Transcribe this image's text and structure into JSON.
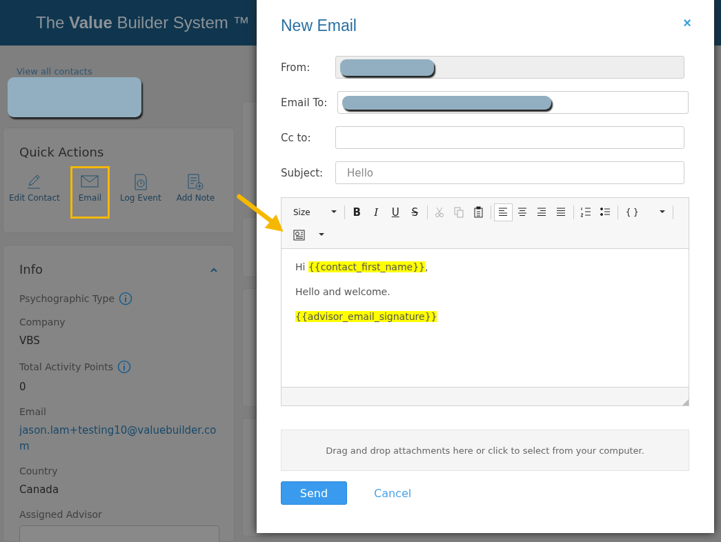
{
  "app_header": {
    "title": "The **Value** Builder System ™"
  },
  "contact": {
    "back_link": "View all contacts",
    "name_redacted": true
  },
  "quick_actions": {
    "title": "Quick Actions",
    "actions": [
      {
        "label": "Edit Contact",
        "highlighted": false
      },
      {
        "label": "Email",
        "highlighted": true
      },
      {
        "label": "Log Event",
        "highlighted": false
      },
      {
        "label": "Add Note",
        "highlighted": false
      }
    ]
  },
  "info": {
    "title": "Info",
    "expanded": true,
    "fields": [
      {
        "label": "Psychographic Type",
        "info": true,
        "kind": "text"
      },
      {
        "label": "Company",
        "value": "VBS",
        "info": false,
        "kind": "text"
      },
      {
        "label": "Total Activity Points",
        "value": "0",
        "info": true,
        "kind": "text"
      },
      {
        "label": "Email",
        "value": "jason.lam+testing10@valuebuilder.com",
        "info": false,
        "kind": "link"
      },
      {
        "label": "Country",
        "value": "Canada",
        "info": false,
        "kind": "text"
      },
      {
        "label": "Assigned Advisor",
        "info": false,
        "kind": "select"
      }
    ]
  },
  "dialog": {
    "title": "New Email",
    "close": "×",
    "fields": [
      {
        "label": "From:",
        "redacted": true,
        "disabled": true
      },
      {
        "label": "Email To:",
        "redacted": true,
        "disabled": false
      },
      {
        "label": "Cc to:",
        "redacted": false,
        "disabled": false
      },
      {
        "label": "Subject:",
        "value": "Hello",
        "redacted": false,
        "disabled": false
      }
    ],
    "editor": {
      "toolbar_rows": [
        [
          {
            "kind": "dropdown",
            "label": "Size"
          },
          {
            "kind": "sep"
          },
          {
            "kind": "format",
            "label": "B"
          },
          {
            "kind": "format",
            "label": "I"
          },
          {
            "kind": "format",
            "label": "U"
          },
          {
            "kind": "format",
            "label": "S"
          },
          {
            "kind": "sep"
          },
          {
            "kind": "icon",
            "disabled": true,
            "selected": false
          },
          {
            "kind": "icon",
            "disabled": true,
            "selected": false
          },
          {
            "kind": "icon",
            "disabled": false,
            "selected": false
          },
          {
            "kind": "sep"
          },
          {
            "kind": "icon",
            "disabled": false,
            "selected": true
          },
          {
            "kind": "icon",
            "disabled": false,
            "selected": false
          },
          {
            "kind": "icon",
            "disabled": false,
            "selected": false
          },
          {
            "kind": "icon",
            "disabled": false,
            "selected": false
          },
          {
            "kind": "sep"
          },
          {
            "kind": "icon",
            "disabled": false,
            "selected": false
          },
          {
            "kind": "icon",
            "disabled": false,
            "selected": false
          },
          {
            "kind": "sep"
          },
          {
            "kind": "dropdown",
            "label": "{ }"
          },
          {
            "kind": "sep"
          }
        ],
        [
          {
            "kind": "icon-dropdown"
          }
        ]
      ],
      "paragraphs": [
        [
          {
            "text": "Hi ",
            "highlighted": false
          },
          {
            "text": "{{contact_first_name}}",
            "highlighted": true
          },
          {
            "text": ",",
            "highlighted": false
          }
        ],
        [
          {
            "text": "Hello and welcome.",
            "highlighted": false
          }
        ],
        [
          {
            "text": "{{advisor_email_signature}}",
            "highlighted": true
          }
        ]
      ]
    },
    "dropzone": "Drag and drop attachments here or click to select from your computer.",
    "buttons": [
      {
        "label": "Send",
        "kind": "primary"
      },
      {
        "label": "Cancel",
        "kind": "link"
      }
    ]
  }
}
